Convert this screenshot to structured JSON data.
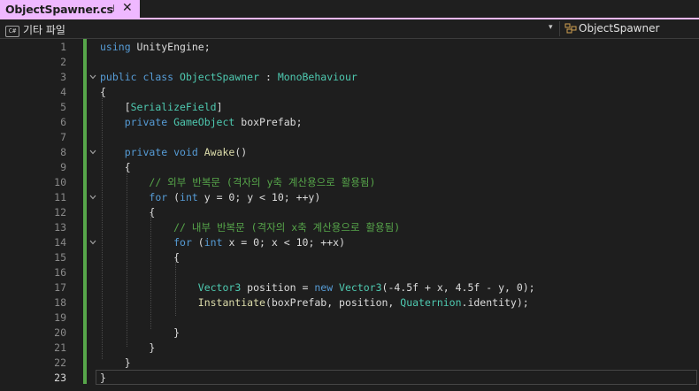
{
  "tab": {
    "title": "ObjectSpawner.cs",
    "pin_glyph": "⊣",
    "close_glyph": "✕"
  },
  "navbar": {
    "project": "기타 파일",
    "project_icon": "C#",
    "member": "ObjectSpawner",
    "dropdown_glyph": "▾"
  },
  "colors": {
    "accent_tab": "#efb8ff",
    "changed_bar": "#57a64a",
    "keyword": "#569cd6",
    "type": "#4ec9b0",
    "comment": "#57a64a"
  },
  "lines": [
    {
      "n": "1",
      "tokens": [
        {
          "t": "using ",
          "c": "kw"
        },
        {
          "t": "UnityEngine;",
          "c": ""
        }
      ]
    },
    {
      "n": "2",
      "tokens": []
    },
    {
      "n": "3",
      "tokens": [
        {
          "t": "public ",
          "c": "kw"
        },
        {
          "t": "class ",
          "c": "kw"
        },
        {
          "t": "ObjectSpawner",
          "c": "ty"
        },
        {
          "t": " : ",
          "c": ""
        },
        {
          "t": "MonoBehaviour",
          "c": "ty"
        }
      ]
    },
    {
      "n": "4",
      "tokens": [
        {
          "t": "{",
          "c": ""
        }
      ]
    },
    {
      "n": "5",
      "tokens": [
        {
          "t": "    [",
          "c": ""
        },
        {
          "t": "SerializeField",
          "c": "ty"
        },
        {
          "t": "]",
          "c": ""
        }
      ]
    },
    {
      "n": "6",
      "tokens": [
        {
          "t": "    ",
          "c": ""
        },
        {
          "t": "private ",
          "c": "kw"
        },
        {
          "t": "GameObject",
          "c": "ty"
        },
        {
          "t": " boxPrefab;",
          "c": ""
        }
      ]
    },
    {
      "n": "7",
      "tokens": []
    },
    {
      "n": "8",
      "tokens": [
        {
          "t": "    ",
          "c": ""
        },
        {
          "t": "private ",
          "c": "kw"
        },
        {
          "t": "void ",
          "c": "kw"
        },
        {
          "t": "Awake",
          "c": "fn"
        },
        {
          "t": "()",
          "c": ""
        }
      ]
    },
    {
      "n": "9",
      "tokens": [
        {
          "t": "    {",
          "c": ""
        }
      ]
    },
    {
      "n": "10",
      "tokens": [
        {
          "t": "        ",
          "c": ""
        },
        {
          "t": "// 외부 반복문 (격자의 y축 계산용으로 활용됨)",
          "c": "cm"
        }
      ]
    },
    {
      "n": "11",
      "tokens": [
        {
          "t": "        ",
          "c": ""
        },
        {
          "t": "for",
          "c": "kw"
        },
        {
          "t": " (",
          "c": ""
        },
        {
          "t": "int",
          "c": "kw"
        },
        {
          "t": " y = 0; y < 10; ++y)",
          "c": ""
        }
      ]
    },
    {
      "n": "12",
      "tokens": [
        {
          "t": "        {",
          "c": ""
        }
      ]
    },
    {
      "n": "13",
      "tokens": [
        {
          "t": "            ",
          "c": ""
        },
        {
          "t": "// 내부 반복문 (격자의 x축 계산용으로 활용됨)",
          "c": "cm"
        }
      ]
    },
    {
      "n": "14",
      "tokens": [
        {
          "t": "            ",
          "c": ""
        },
        {
          "t": "for",
          "c": "kw"
        },
        {
          "t": " (",
          "c": ""
        },
        {
          "t": "int",
          "c": "kw"
        },
        {
          "t": " x = 0; x < 10; ++x)",
          "c": ""
        }
      ]
    },
    {
      "n": "15",
      "tokens": [
        {
          "t": "            {",
          "c": ""
        }
      ]
    },
    {
      "n": "16",
      "tokens": []
    },
    {
      "n": "17",
      "tokens": [
        {
          "t": "                ",
          "c": ""
        },
        {
          "t": "Vector3",
          "c": "ty"
        },
        {
          "t": " position = ",
          "c": ""
        },
        {
          "t": "new ",
          "c": "kw"
        },
        {
          "t": "Vector3",
          "c": "ty"
        },
        {
          "t": "(-4.5f + x, 4.5f - y, 0);",
          "c": ""
        }
      ]
    },
    {
      "n": "18",
      "tokens": [
        {
          "t": "                ",
          "c": ""
        },
        {
          "t": "Instantiate",
          "c": "fn"
        },
        {
          "t": "(boxPrefab, position, ",
          "c": ""
        },
        {
          "t": "Quaternion",
          "c": "ty"
        },
        {
          "t": ".identity);",
          "c": ""
        }
      ]
    },
    {
      "n": "19",
      "tokens": []
    },
    {
      "n": "20",
      "tokens": [
        {
          "t": "            }",
          "c": ""
        }
      ]
    },
    {
      "n": "21",
      "tokens": [
        {
          "t": "        }",
          "c": ""
        }
      ]
    },
    {
      "n": "22",
      "tokens": [
        {
          "t": "    }",
          "c": ""
        }
      ]
    },
    {
      "n": "23",
      "tokens": [
        {
          "t": "}",
          "c": ""
        }
      ]
    }
  ],
  "current_line": "23"
}
